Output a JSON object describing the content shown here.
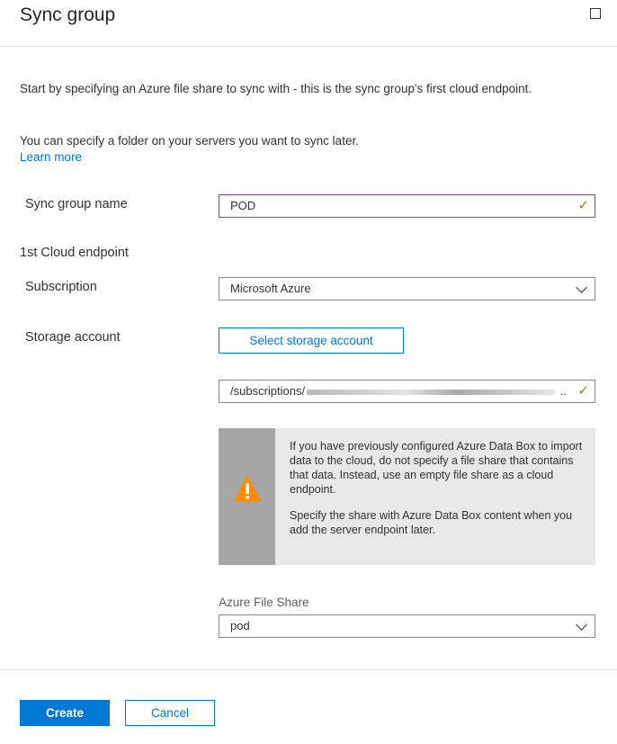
{
  "header": {
    "title": "Sync group",
    "maximize_icon": "square-icon"
  },
  "intro": {
    "line1": "Start by specifying an Azure file share to sync with - this is the sync group's first cloud endpoint.",
    "line2": "You can specify a folder on your servers you want to sync later.",
    "learn_more": "Learn more"
  },
  "form": {
    "sync_group_name_label": "Sync group name",
    "sync_group_name_value": "POD",
    "cloud_endpoint_heading": "1st Cloud endpoint",
    "subscription_label": "Subscription",
    "subscription_value": "Microsoft Azure",
    "storage_account_label": "Storage account",
    "select_storage_button": "Select storage account",
    "storage_path_prefix": "/subscriptions/",
    "storage_path_suffix": ".."
  },
  "warning": {
    "icon": "warning-icon",
    "paragraph1": "If you have previously configured Azure Data Box to import data to the cloud, do not specify a file share that contains that data. Instead, use an empty file share as a cloud endpoint.",
    "paragraph2": "Specify the share with Azure Data Box content when you add the server endpoint later.",
    "accent_color": "#ff8c00"
  },
  "file_share": {
    "label": "Azure File Share",
    "value": "pod"
  },
  "footer": {
    "create_label": "Create",
    "cancel_label": "Cancel"
  },
  "colors": {
    "primary": "#0078d4",
    "valid_check": "#57a300",
    "focus_border": "#8a3d9c"
  }
}
